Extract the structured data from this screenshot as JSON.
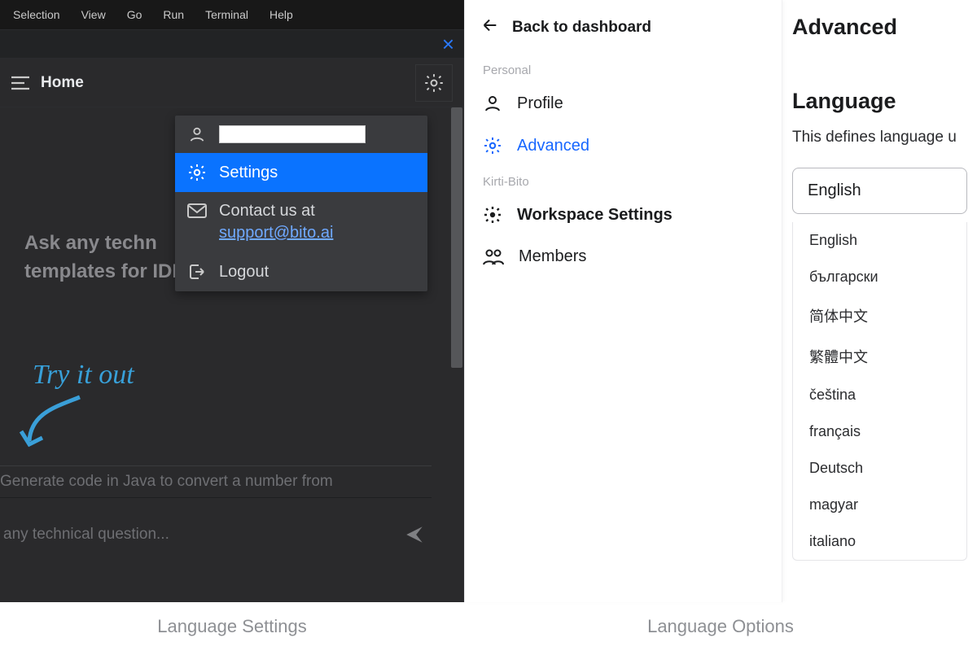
{
  "menubar": [
    "Selection",
    "View",
    "Go",
    "Run",
    "Terminal",
    "Help"
  ],
  "panel": {
    "home_label": "Home",
    "prompt_text": "Ask any techn templates for IDE",
    "try_it": "Try it out",
    "suggestion": "Generate code in Java to convert a number from",
    "input_placeholder": "any technical question..."
  },
  "popup": {
    "settings": "Settings",
    "contact_prefix": "Contact us at",
    "contact_email": "support@bito.ai",
    "logout": "Logout"
  },
  "sidebar": {
    "back": "Back to dashboard",
    "section1": "Personal",
    "profile": "Profile",
    "advanced": "Advanced",
    "section2": "Kirti-Bito",
    "workspace": "Workspace Settings",
    "members": "Members"
  },
  "settings": {
    "title": "Advanced",
    "lang_title": "Language",
    "lang_desc": "This defines language u",
    "selected": "English",
    "options": [
      "English",
      "български",
      "简体中文",
      "繁體中文",
      "čeština",
      "français",
      "Deutsch",
      "magyar",
      "italiano"
    ]
  },
  "captions": {
    "left": "Language Settings",
    "right": "Language Options"
  }
}
